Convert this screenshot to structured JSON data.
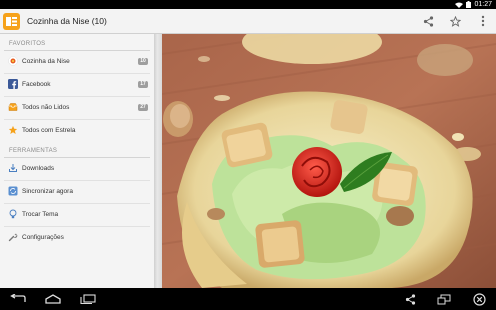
{
  "status_bar": {
    "time": "01:27",
    "wifi_icon": "wifi-icon",
    "battery_icon": "battery-icon"
  },
  "action_bar": {
    "title": "Cozinha da Nise (10)",
    "app_icon": "feed-reader-logo",
    "share_icon": "share-icon",
    "star_icon": "star-outline-icon",
    "overflow_icon": "overflow-menu-icon"
  },
  "drawer": {
    "favorites_header": "FAVORITOS",
    "tools_header": "FERRAMENTAS",
    "favorites": [
      {
        "label": "Cozinha da Nise",
        "badge": "10",
        "icon": "site-favicon-icon"
      },
      {
        "label": "Facebook",
        "badge": "17",
        "icon": "facebook-icon"
      },
      {
        "label": "Todos não Lidos",
        "badge": "27",
        "icon": "unread-inbox-icon"
      },
      {
        "label": "Todos com Estrela",
        "icon": "star-icon"
      }
    ],
    "tools": [
      {
        "label": "Downloads",
        "icon": "download-icon"
      },
      {
        "label": "Sincronizar agora",
        "icon": "sync-icon"
      },
      {
        "label": "Trocar Tema",
        "icon": "theme-bulb-icon"
      },
      {
        "label": "Configurações",
        "icon": "wrench-icon"
      }
    ]
  },
  "article": {
    "image": "photo of a salad served in a crispy parmesan cheese basket with croutons, lettuce, walnuts and a tomato rose"
  },
  "nav_bar": {
    "back_icon": "back-icon",
    "home_icon": "home-icon",
    "recents_icon": "recent-apps-icon",
    "share_icon": "share-icon",
    "screen_icon": "screen-rotate-icon",
    "close_icon": "close-circle-icon"
  },
  "colors": {
    "action_bar_bg": "#f3f3f3",
    "drawer_bg": "#f4f4f4",
    "badge_bg": "#9e9e9e",
    "accent": "#f6a21b"
  }
}
